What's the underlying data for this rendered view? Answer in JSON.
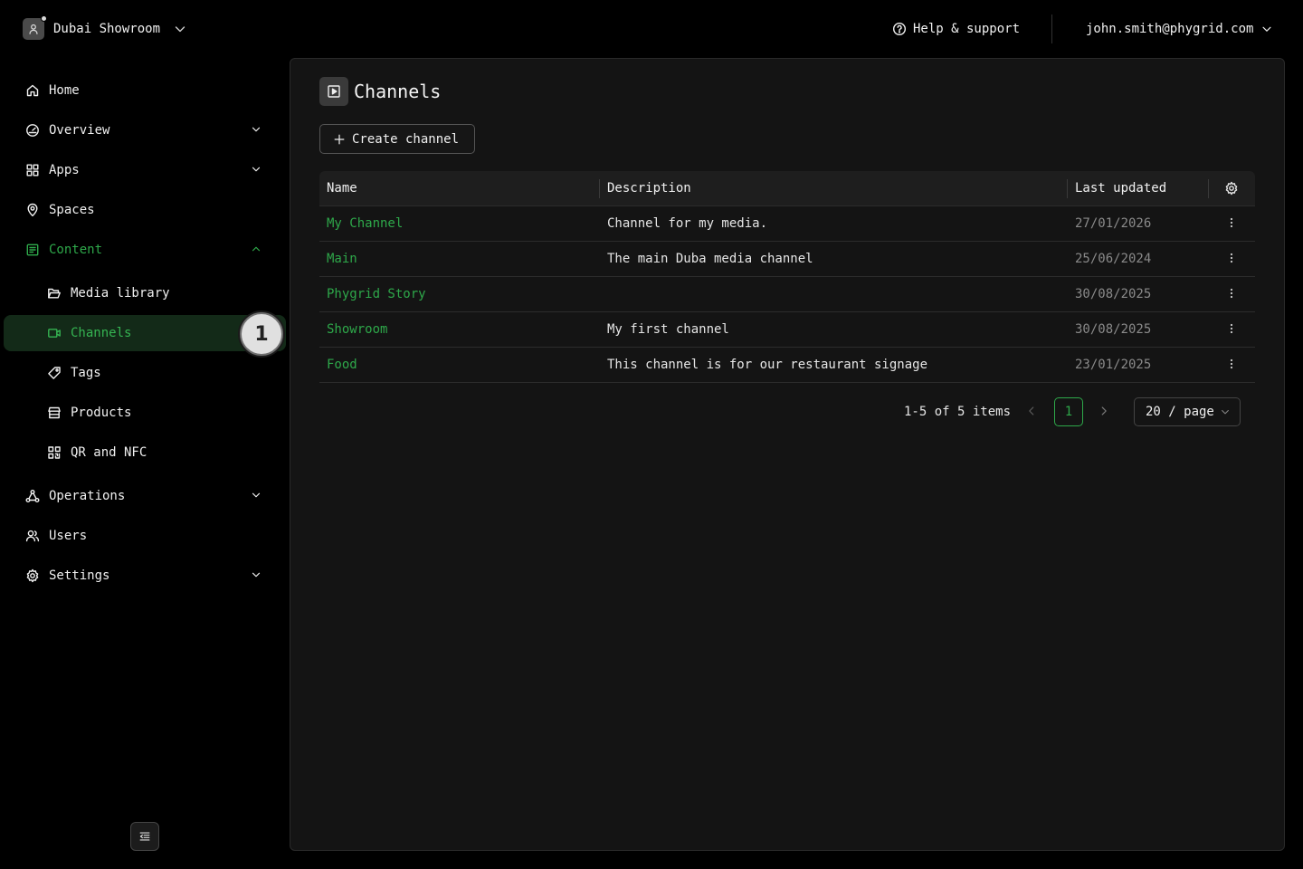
{
  "header": {
    "org_name": "Dubai Showroom",
    "help_label": "Help & support",
    "user_email": "john.smith@phygrid.com"
  },
  "sidebar": {
    "items": [
      {
        "label": "Home",
        "icon": "home-icon"
      },
      {
        "label": "Overview",
        "icon": "dashboard-icon"
      },
      {
        "label": "Apps",
        "icon": "apps-grid-icon"
      },
      {
        "label": "Spaces",
        "icon": "location-pin-icon"
      },
      {
        "label": "Content",
        "icon": "content-icon"
      },
      {
        "label": "Media library",
        "icon": "folder-open-icon"
      },
      {
        "label": "Channels",
        "icon": "video-camera-icon"
      },
      {
        "label": "Tags",
        "icon": "tag-icon"
      },
      {
        "label": "Products",
        "icon": "shop-icon"
      },
      {
        "label": "QR and NFC",
        "icon": "qrcode-icon"
      },
      {
        "label": "Operations",
        "icon": "network-icon"
      },
      {
        "label": "Users",
        "icon": "users-icon"
      },
      {
        "label": "Settings",
        "icon": "gear-icon"
      }
    ],
    "step_badge": "1"
  },
  "page": {
    "title": "Channels",
    "create_label": "Create channel"
  },
  "table": {
    "columns": [
      "Name",
      "Description",
      "Last updated"
    ],
    "rows": [
      {
        "name": "My Channel",
        "description": "Channel for my media.",
        "updated": "27/01/2026"
      },
      {
        "name": "Main",
        "description": "The main Duba media channel",
        "updated": "25/06/2024"
      },
      {
        "name": "Phygrid Story",
        "description": "",
        "updated": "30/08/2025"
      },
      {
        "name": "Showroom",
        "description": "My first channel",
        "updated": "30/08/2025"
      },
      {
        "name": "Food",
        "description": "This channel is for our restaurant signage",
        "updated": "23/01/2025"
      }
    ]
  },
  "pagination": {
    "info": "1-5 of 5 items",
    "current_page": "1",
    "page_size": "20 / page"
  },
  "colors": {
    "accent": "#2ea84a",
    "active_bg": "#132a18",
    "panel_bg": "#141414"
  }
}
